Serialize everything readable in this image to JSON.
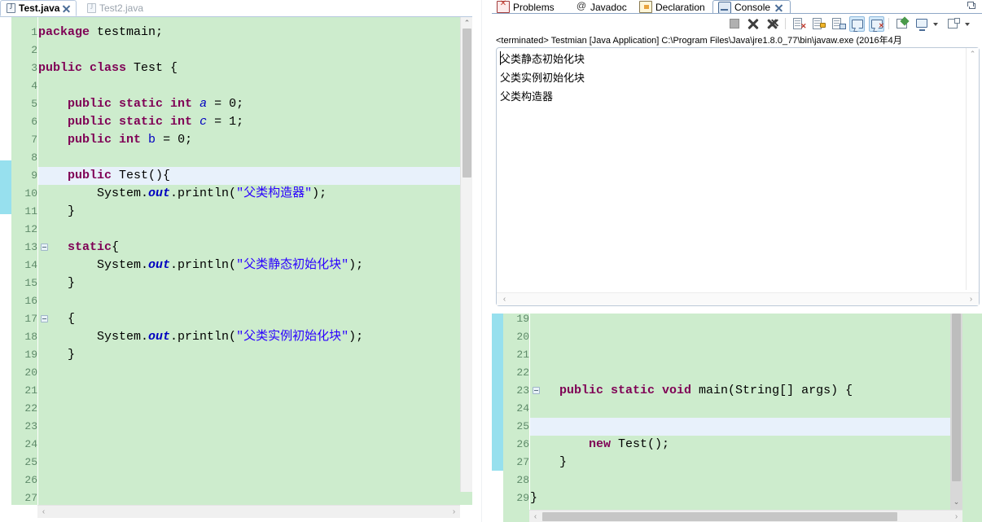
{
  "app": "Eclipse IDE",
  "editor_tabs": [
    {
      "label": "Test.java",
      "icon": "java-file-icon",
      "active": true,
      "closable": true
    },
    {
      "label": "Test2.java",
      "icon": "java-file-icon",
      "active": false,
      "closable": false
    }
  ],
  "left_editor": {
    "first_line": 1,
    "last_line": 27,
    "current_line": 9,
    "lines": [
      {
        "n": 1,
        "fold": false,
        "tokens": [
          {
            "t": "package",
            "c": "k"
          },
          {
            "t": " testmain;",
            "c": "p"
          }
        ]
      },
      {
        "n": 2,
        "fold": false,
        "tokens": []
      },
      {
        "n": 3,
        "fold": false,
        "tokens": [
          {
            "t": "public class",
            "c": "k"
          },
          {
            "t": " Test {",
            "c": "p"
          }
        ]
      },
      {
        "n": 4,
        "fold": false,
        "tokens": []
      },
      {
        "n": 5,
        "fold": false,
        "tokens": [
          {
            "t": "    ",
            "c": "p"
          },
          {
            "t": "public static int",
            "c": "k"
          },
          {
            "t": " ",
            "c": "p"
          },
          {
            "t": "a",
            "c": "fi"
          },
          {
            "t": " = 0;",
            "c": "p"
          }
        ]
      },
      {
        "n": 6,
        "fold": false,
        "tokens": [
          {
            "t": "    ",
            "c": "p"
          },
          {
            "t": "public static int",
            "c": "k"
          },
          {
            "t": " ",
            "c": "p"
          },
          {
            "t": "c",
            "c": "fi"
          },
          {
            "t": " = 1;",
            "c": "p"
          }
        ]
      },
      {
        "n": 7,
        "fold": false,
        "tokens": [
          {
            "t": "    ",
            "c": "p"
          },
          {
            "t": "public int",
            "c": "k"
          },
          {
            "t": " ",
            "c": "p"
          },
          {
            "t": "b",
            "c": "f"
          },
          {
            "t": " = 0;",
            "c": "p"
          }
        ]
      },
      {
        "n": 8,
        "fold": false,
        "tokens": []
      },
      {
        "n": 9,
        "fold": true,
        "tokens": [
          {
            "t": "    ",
            "c": "p"
          },
          {
            "t": "public",
            "c": "k"
          },
          {
            "t": " Test(){",
            "c": "p"
          }
        ]
      },
      {
        "n": 10,
        "fold": false,
        "tokens": [
          {
            "t": "        System.",
            "c": "p"
          },
          {
            "t": "out",
            "c": "so"
          },
          {
            "t": ".println(",
            "c": "p"
          },
          {
            "t": "\"父类构造器\"",
            "c": "s"
          },
          {
            "t": ");",
            "c": "p"
          }
        ]
      },
      {
        "n": 11,
        "fold": false,
        "tokens": [
          {
            "t": "    }",
            "c": "p"
          }
        ]
      },
      {
        "n": 12,
        "fold": false,
        "tokens": []
      },
      {
        "n": 13,
        "fold": true,
        "tokens": [
          {
            "t": "    ",
            "c": "p"
          },
          {
            "t": "static",
            "c": "k"
          },
          {
            "t": "{",
            "c": "p"
          }
        ]
      },
      {
        "n": 14,
        "fold": false,
        "tokens": [
          {
            "t": "        System.",
            "c": "p"
          },
          {
            "t": "out",
            "c": "so"
          },
          {
            "t": ".println(",
            "c": "p"
          },
          {
            "t": "\"父类静态初始化块\"",
            "c": "s"
          },
          {
            "t": ");",
            "c": "p"
          }
        ]
      },
      {
        "n": 15,
        "fold": false,
        "tokens": [
          {
            "t": "    }",
            "c": "p"
          }
        ]
      },
      {
        "n": 16,
        "fold": false,
        "tokens": []
      },
      {
        "n": 17,
        "fold": true,
        "tokens": [
          {
            "t": "    {",
            "c": "p"
          }
        ]
      },
      {
        "n": 18,
        "fold": false,
        "tokens": [
          {
            "t": "        System.",
            "c": "p"
          },
          {
            "t": "out",
            "c": "so"
          },
          {
            "t": ".println(",
            "c": "p"
          },
          {
            "t": "\"父类实例初始化块\"",
            "c": "s"
          },
          {
            "t": ");",
            "c": "p"
          }
        ]
      },
      {
        "n": 19,
        "fold": false,
        "tokens": [
          {
            "t": "    }",
            "c": "p"
          }
        ]
      },
      {
        "n": 20,
        "fold": false,
        "tokens": []
      },
      {
        "n": 21,
        "fold": false,
        "tokens": []
      },
      {
        "n": 22,
        "fold": false,
        "tokens": []
      },
      {
        "n": 23,
        "fold": false,
        "tokens": []
      },
      {
        "n": 24,
        "fold": false,
        "tokens": []
      },
      {
        "n": 25,
        "fold": false,
        "tokens": []
      },
      {
        "n": 26,
        "fold": false,
        "tokens": []
      },
      {
        "n": 27,
        "fold": false,
        "tokens": []
      }
    ]
  },
  "right_editor": {
    "first_line": 19,
    "last_line": 29,
    "current_line": 25,
    "lines": [
      {
        "n": 19,
        "fold": false,
        "tokens": []
      },
      {
        "n": 20,
        "fold": false,
        "tokens": []
      },
      {
        "n": 21,
        "fold": false,
        "tokens": []
      },
      {
        "n": 22,
        "fold": false,
        "tokens": []
      },
      {
        "n": 23,
        "fold": true,
        "tokens": [
          {
            "t": "    ",
            "c": "p"
          },
          {
            "t": "public static void",
            "c": "k"
          },
          {
            "t": " main(String[] args) {",
            "c": "p"
          }
        ]
      },
      {
        "n": 24,
        "fold": false,
        "tokens": []
      },
      {
        "n": 25,
        "fold": false,
        "tokens": []
      },
      {
        "n": 26,
        "fold": false,
        "tokens": [
          {
            "t": "        ",
            "c": "p"
          },
          {
            "t": "new",
            "c": "k"
          },
          {
            "t": " Test();",
            "c": "p"
          }
        ]
      },
      {
        "n": 27,
        "fold": false,
        "tokens": [
          {
            "t": "    }",
            "c": "p"
          }
        ]
      },
      {
        "n": 28,
        "fold": false,
        "tokens": []
      },
      {
        "n": 29,
        "fold": false,
        "tokens": [
          {
            "t": "}",
            "c": "p"
          }
        ]
      }
    ]
  },
  "console_panel": {
    "tabs": [
      {
        "label": "Problems",
        "icon": "problems-icon",
        "selected": false
      },
      {
        "label": "Javadoc",
        "icon": "javadoc-icon",
        "selected": false
      },
      {
        "label": "Declaration",
        "icon": "declaration-icon",
        "selected": false
      },
      {
        "label": "Console",
        "icon": "console-icon",
        "selected": true,
        "closable": true
      }
    ],
    "minimize_icon": "restore-icon",
    "toolbar": [
      {
        "name": "terminate-button",
        "icon": "stop-square-icon",
        "toggled": false
      },
      {
        "name": "remove-launch-button",
        "icon": "x-icon",
        "toggled": false
      },
      {
        "name": "remove-all-terminated-button",
        "icon": "double-x-icon",
        "toggled": false
      },
      {
        "name": "clear-console-button",
        "icon": "clear-console-icon",
        "toggled": false
      },
      {
        "name": "scroll-lock-button",
        "icon": "lock-icon",
        "toggled": false
      },
      {
        "name": "word-wrap-button",
        "icon": "word-wrap-icon",
        "toggled": false
      },
      {
        "name": "show-console-on-output-button",
        "icon": "console-bubble-icon",
        "toggled": true
      },
      {
        "name": "show-console-on-error-button",
        "icon": "console-bubble-error-icon",
        "toggled": true
      },
      {
        "name": "pin-console-button",
        "icon": "pin-icon",
        "toggled": false
      },
      {
        "name": "display-selected-console-button",
        "icon": "monitor-icon",
        "toggled": false
      },
      {
        "name": "display-selected-console-dropdown",
        "icon": "chevron-down-icon",
        "toggled": false
      },
      {
        "name": "open-console-button",
        "icon": "new-console-icon",
        "toggled": false
      },
      {
        "name": "open-console-dropdown",
        "icon": "chevron-down-icon",
        "toggled": false
      }
    ],
    "status_line": "<terminated> Testmian [Java Application] C:\\Program Files\\Java\\jre1.8.0_77\\bin\\javaw.exe (2016年4月",
    "output_lines": [
      "父类静态初始化块",
      "父类实例初始化块",
      "父类构造器"
    ]
  },
  "colors": {
    "editor_background": "#cdeccd",
    "current_line_highlight": "#e8f1fb",
    "keyword": "#7f0055",
    "string": "#2a00ff",
    "field": "#0000c0",
    "line_number": "#5f8a6a",
    "annotation_marker": "#74d5e8",
    "tab_border": "#8fa8c6"
  },
  "scroll": {
    "left_vertical_arrow_up": "⌃",
    "left_horizontal_arrow_left": "‹",
    "left_horizontal_arrow_right": "›",
    "console_arrow_up": "⌃",
    "console_arrow_left": "‹",
    "console_arrow_right": "›",
    "right_arrow_down": "⌄",
    "right_arrow_left": "‹",
    "right_arrow_right": "›"
  }
}
